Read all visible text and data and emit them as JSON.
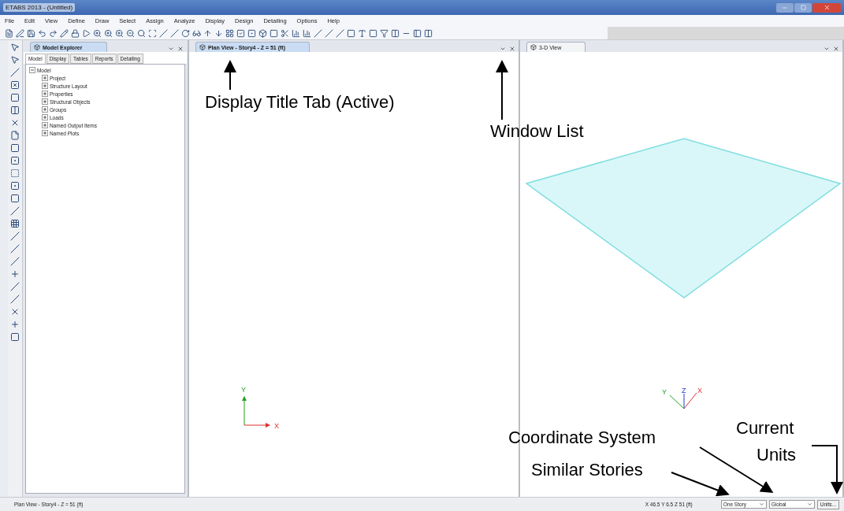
{
  "window": {
    "title": "ETABS 2013 - (Untitled)"
  },
  "menu": [
    "File",
    "Edit",
    "View",
    "Define",
    "Draw",
    "Select",
    "Assign",
    "Analyze",
    "Display",
    "Design",
    "Detailing",
    "Options",
    "Help"
  ],
  "explorer": {
    "title": "Model Explorer",
    "tabs": [
      {
        "label": "Model",
        "selected": true
      },
      {
        "label": "Display",
        "selected": false
      },
      {
        "label": "Tables",
        "selected": false
      },
      {
        "label": "Reports",
        "selected": false
      },
      {
        "label": "Detailing",
        "selected": false
      }
    ],
    "tree": [
      {
        "label": "Model",
        "expanded": true,
        "children": [
          {
            "label": "Project",
            "expanded": false
          },
          {
            "label": "Structure Layout",
            "expanded": false
          },
          {
            "label": "Properties",
            "expanded": false
          },
          {
            "label": "Structural Objects",
            "expanded": false
          },
          {
            "label": "Groups",
            "expanded": false
          },
          {
            "label": "Loads",
            "expanded": false
          },
          {
            "label": "Named Output Items",
            "expanded": false
          },
          {
            "label": "Named Plots",
            "expanded": false
          }
        ]
      }
    ]
  },
  "views": [
    {
      "title": "Plan View - Story4 - Z = 51 (ft)",
      "active": true,
      "kind": "plan",
      "axes": [
        "X",
        "Y"
      ]
    },
    {
      "title": "3-D View",
      "active": false,
      "kind": "perspective",
      "axes": [
        "Y",
        "Z",
        "X"
      ]
    }
  ],
  "status_bar": {
    "text": "Plan View - Story4 - Z = 51 (ft)",
    "coordinates": "X 46.5  Y 6.5  Z 51 (ft)",
    "stories": "One Story",
    "coord_system": "Global",
    "units_button": "Units..."
  },
  "annotations": [
    "Display Title Tab (Active)",
    "Window List",
    "Coordinate System",
    "Similar Stories",
    "Current",
    "Units"
  ]
}
